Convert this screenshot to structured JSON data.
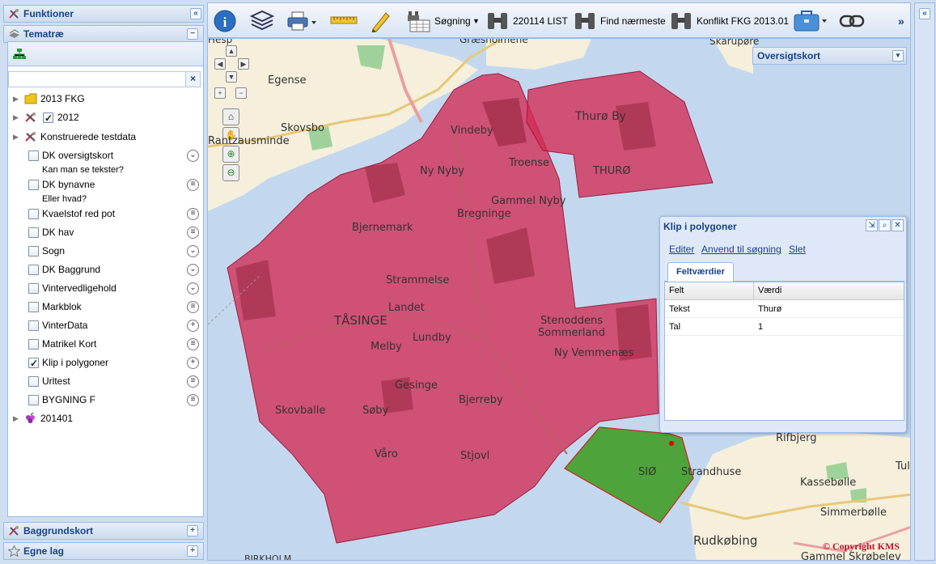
{
  "left_panel": {
    "funktioner": "Funktioner",
    "tematrae": "Tematræ",
    "filter_clear": "×",
    "baggrundskort": "Baggrundskort",
    "egne_lag": "Egne lag"
  },
  "tree": [
    {
      "label": "2013 FKG",
      "icon": "folder-icon"
    },
    {
      "label": "2012",
      "icon": "tools-icon",
      "checked": true
    },
    {
      "label": "Konstruerede testdata",
      "icon": "tools-icon"
    },
    {
      "label": "DK oversigtskort",
      "sub": "Kan man se tekster?",
      "action": "chevron-circle-icon"
    },
    {
      "label": "DK bynavne",
      "sub": "Eller hvad?",
      "action": "menu-circle-icon"
    },
    {
      "label": "Kvaelstof red pot",
      "action": "menu-circle-icon"
    },
    {
      "label": "DK hav",
      "action": "menu-circle-icon"
    },
    {
      "label": "Sogn",
      "action": "chevron-circle-icon"
    },
    {
      "label": "DK Baggrund",
      "action": "chevron-circle-icon"
    },
    {
      "label": "Vintervedligehold",
      "action": "chevron-circle-icon"
    },
    {
      "label": "Markblok",
      "action": "menu-circle-icon"
    },
    {
      "label": "VinterData",
      "action": "plus-circle-icon"
    },
    {
      "label": "Matrikel Kort",
      "action": "menu-circle-icon"
    },
    {
      "label": "Klip i polygoner",
      "checked": true,
      "action": "plus-circle-icon"
    },
    {
      "label": "Urltest",
      "action": "menu-circle-icon"
    },
    {
      "label": "BYGNING F",
      "action": "menu-circle-icon"
    },
    {
      "label": "201401",
      "icon": "grapes-icon"
    }
  ],
  "toolbar": {
    "search": "Søgning",
    "list": "220114 LIST",
    "nearest": "Find nærmeste",
    "conflict": "Konflikt FKG 2013.01",
    "more": "»"
  },
  "overview": {
    "label": "Oversigtskort"
  },
  "popup": {
    "title": "Klip i polygoner",
    "links": [
      "Editer",
      "Anvend til søgning",
      "Slet"
    ],
    "tab": "Feltværdier",
    "headers": [
      "Felt",
      "Værdi"
    ],
    "rows": [
      [
        "Tekst",
        "Thurø"
      ],
      [
        "Tal",
        "1"
      ]
    ]
  },
  "map_labels": {
    "egense": "Egense",
    "skovsbo": "Skovsbo",
    "rantzausminde": "Rantzausminde",
    "vindeby": "Vindeby",
    "thuro_by": "Thurø By",
    "thuro": "THURØ",
    "ny_nyby": "Ny Nyby",
    "troense": "Troense",
    "gammel_nyby": "Gammel Nyby",
    "bregninge": "Bregninge",
    "bjernemark": "Bjernemark",
    "strammelse": "Strammelse",
    "landet": "Landet",
    "tasinge": "TÅSINGE",
    "lundby": "Lundby",
    "melby": "Melby",
    "stenoddens": "Stenoddens",
    "sommerland": "Sommerland",
    "ny_vemmenaes": "Ny Vemmenæs",
    "gesinge": "Gesinge",
    "bjerreby": "Bjerreby",
    "skovballe": "Skovballe",
    "soby": "Søby",
    "vaaro": "Våro",
    "stjovl": "Stjovl",
    "sio": "SIØ",
    "strandhuse": "Strandhuse",
    "rifbjerg": "Rifbjerg",
    "tul": "Tul",
    "kassebolle": "Kassebølle",
    "simmerbolle": "Simmerbølle",
    "rudkobing": "Rudkøbing",
    "gammel_skrobelev": "Gammel Skrøbelev",
    "skarupore": "Skarupøre",
    "graesholmene": "Græsholmene",
    "borholm": "BIRKHOLM",
    "hesp": "Hesp"
  },
  "copyright": "© Copyright KMS"
}
